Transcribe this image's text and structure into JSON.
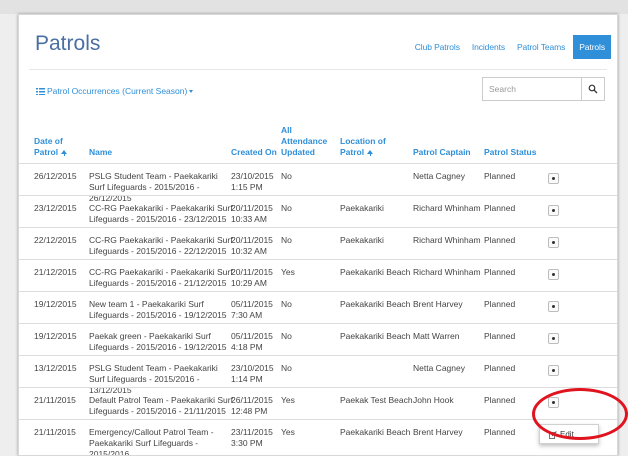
{
  "page": {
    "title": "Patrols"
  },
  "nav": {
    "tabs": [
      {
        "label": "Club Patrols"
      },
      {
        "label": "Incidents"
      },
      {
        "label": "Patrol Teams"
      },
      {
        "label": "Patrols",
        "active": true
      }
    ]
  },
  "filter": {
    "label": "Patrol Occurrences (Current Season)"
  },
  "search": {
    "placeholder": "Search"
  },
  "table": {
    "columns": [
      {
        "label": "Date of Patrol",
        "sorted": "asc"
      },
      {
        "label": "Name"
      },
      {
        "label": "Created On"
      },
      {
        "label": "All Attendance Updated"
      },
      {
        "label": "Location of Patrol",
        "sorted": "asc"
      },
      {
        "label": "Patrol Captain"
      },
      {
        "label": "Patrol Status"
      }
    ],
    "rows": [
      {
        "date": "26/12/2015",
        "name": "PSLG Student Team - Paekakariki Surf Lifeguards - 2015/2016 - 26/12/2015",
        "created": "23/10/2015 1:15 PM",
        "attendance": "No",
        "location": "",
        "captain": "Netta Cagney",
        "status": "Planned"
      },
      {
        "date": "23/12/2015",
        "name": "CC-RG Paekakariki - Paekakariki Surf Lifeguards - 2015/2016 - 23/12/2015",
        "created": "20/11/2015 10:33 AM",
        "attendance": "No",
        "location": "Paekakariki",
        "captain": "Richard Whinham",
        "status": "Planned"
      },
      {
        "date": "22/12/2015",
        "name": "CC-RG Paekakariki - Paekakariki Surf Lifeguards - 2015/2016 - 22/12/2015",
        "created": "20/11/2015 10:32 AM",
        "attendance": "No",
        "location": "Paekakariki",
        "captain": "Richard Whinham",
        "status": "Planned"
      },
      {
        "date": "21/12/2015",
        "name": "CC-RG Paekakariki - Paekakariki Surf Lifeguards - 2015/2016 - 21/12/2015",
        "created": "20/11/2015 10:29 AM",
        "attendance": "Yes",
        "location": "Paekakariki Beach",
        "captain": "Richard Whinham",
        "status": "Planned"
      },
      {
        "date": "19/12/2015",
        "name": "New team 1 - Paekakariki Surf Lifeguards - 2015/2016 - 19/12/2015",
        "created": "05/11/2015 7:30 AM",
        "attendance": "No",
        "location": "Paekakariki Beach",
        "captain": "Brent Harvey",
        "status": "Planned"
      },
      {
        "date": "19/12/2015",
        "name": "Paekak green - Paekakariki Surf Lifeguards - 2015/2016 - 19/12/2015",
        "created": "05/11/2015 4:18 PM",
        "attendance": "No",
        "location": "Paekakariki Beach",
        "captain": "Matt Warren",
        "status": "Planned"
      },
      {
        "date": "13/12/2015",
        "name": "PSLG Student Team - Paekakariki Surf Lifeguards - 2015/2016 - 13/12/2015",
        "created": "23/10/2015 1:14 PM",
        "attendance": "No",
        "location": "",
        "captain": "Netta Cagney",
        "status": "Planned"
      },
      {
        "date": "21/11/2015",
        "name": "Default Patrol Team - Paekakariki Surf Lifeguards - 2015/2016 - 21/11/2015",
        "created": "26/11/2015 12:48 PM",
        "attendance": "Yes",
        "location": "Paekak Test Beach",
        "captain": "John Hook",
        "status": "Planned"
      },
      {
        "date": "21/11/2015",
        "name": "Emergency/Callout Patrol Team - Paekakariki Surf Lifeguards - 2015/2016",
        "created": "23/11/2015 3:30 PM",
        "attendance": "Yes",
        "location": "Paekakariki Beach",
        "captain": "Brent Harvey",
        "status": "Planned"
      }
    ]
  },
  "dropdown": {
    "edit_label": "Edit"
  },
  "colors": {
    "accent": "#2f8fd8",
    "title": "#4a6fa3",
    "highlight": "#e0141f"
  }
}
